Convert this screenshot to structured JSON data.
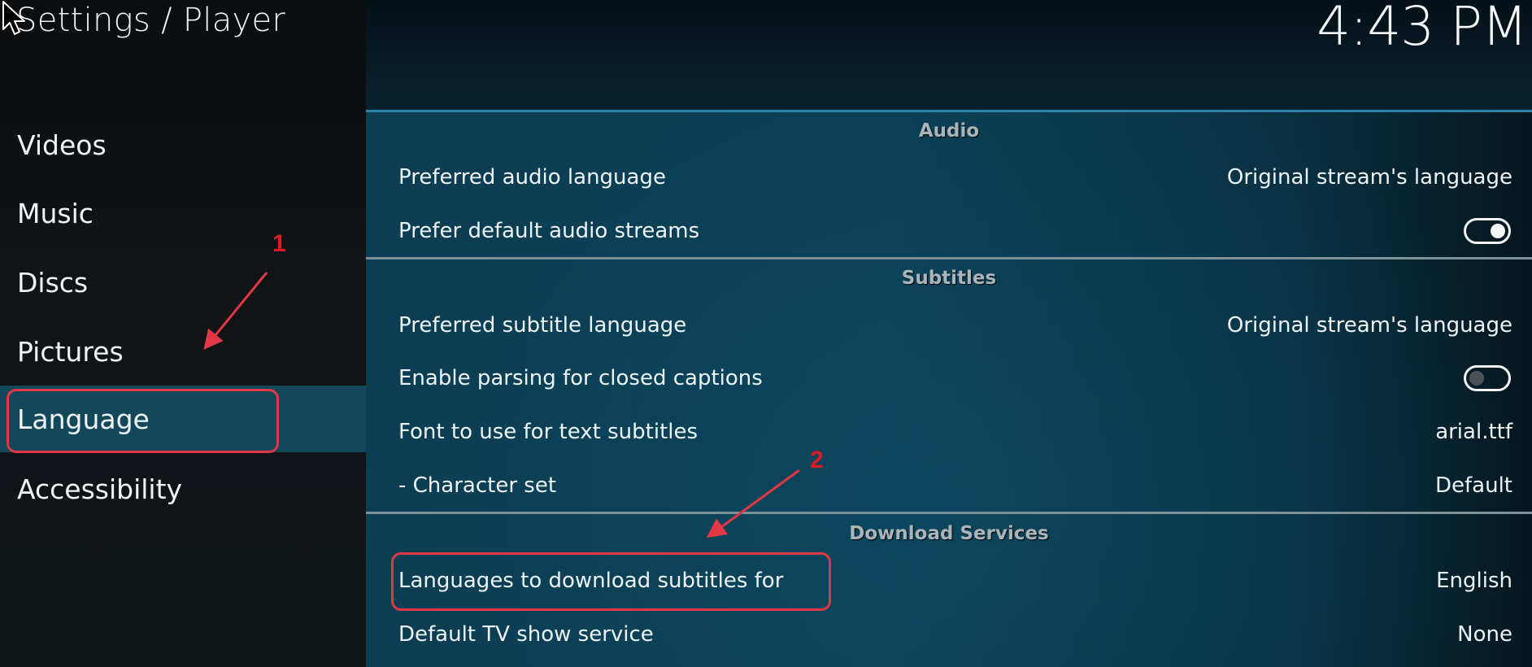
{
  "header": {
    "title": "Settings / Player",
    "clock": "4:43 PM"
  },
  "sidebar": {
    "items": [
      {
        "label": "Videos",
        "active": false
      },
      {
        "label": "Music",
        "active": false
      },
      {
        "label": "Discs",
        "active": false
      },
      {
        "label": "Pictures",
        "active": false
      },
      {
        "label": "Language",
        "active": true
      },
      {
        "label": "Accessibility",
        "active": false
      }
    ]
  },
  "sections": [
    {
      "title": "Audio",
      "rows": [
        {
          "label": "Preferred audio language",
          "value": "Original stream's language"
        },
        {
          "label": "Prefer default audio streams",
          "toggle": true
        }
      ]
    },
    {
      "title": "Subtitles",
      "rows": [
        {
          "label": "Preferred subtitle language",
          "value": "Original stream's language"
        },
        {
          "label": "Enable parsing for closed captions",
          "toggle": false
        },
        {
          "label": "Font to use for text subtitles",
          "value": "arial.ttf"
        },
        {
          "label": "- Character set",
          "value": "Default"
        }
      ]
    },
    {
      "title": "Download Services",
      "rows": [
        {
          "label": "Languages to download subtitles for",
          "value": "English"
        },
        {
          "label": "Default TV show service",
          "value": "None"
        }
      ]
    }
  ],
  "annotations": {
    "marker_1": "1",
    "marker_2": "2",
    "color": "#e23744"
  },
  "colors": {
    "sidebar_bg": "#101417",
    "active_item_bg": "#12485a",
    "accent_line": "#2a84a6",
    "separator": "#7d9199"
  }
}
